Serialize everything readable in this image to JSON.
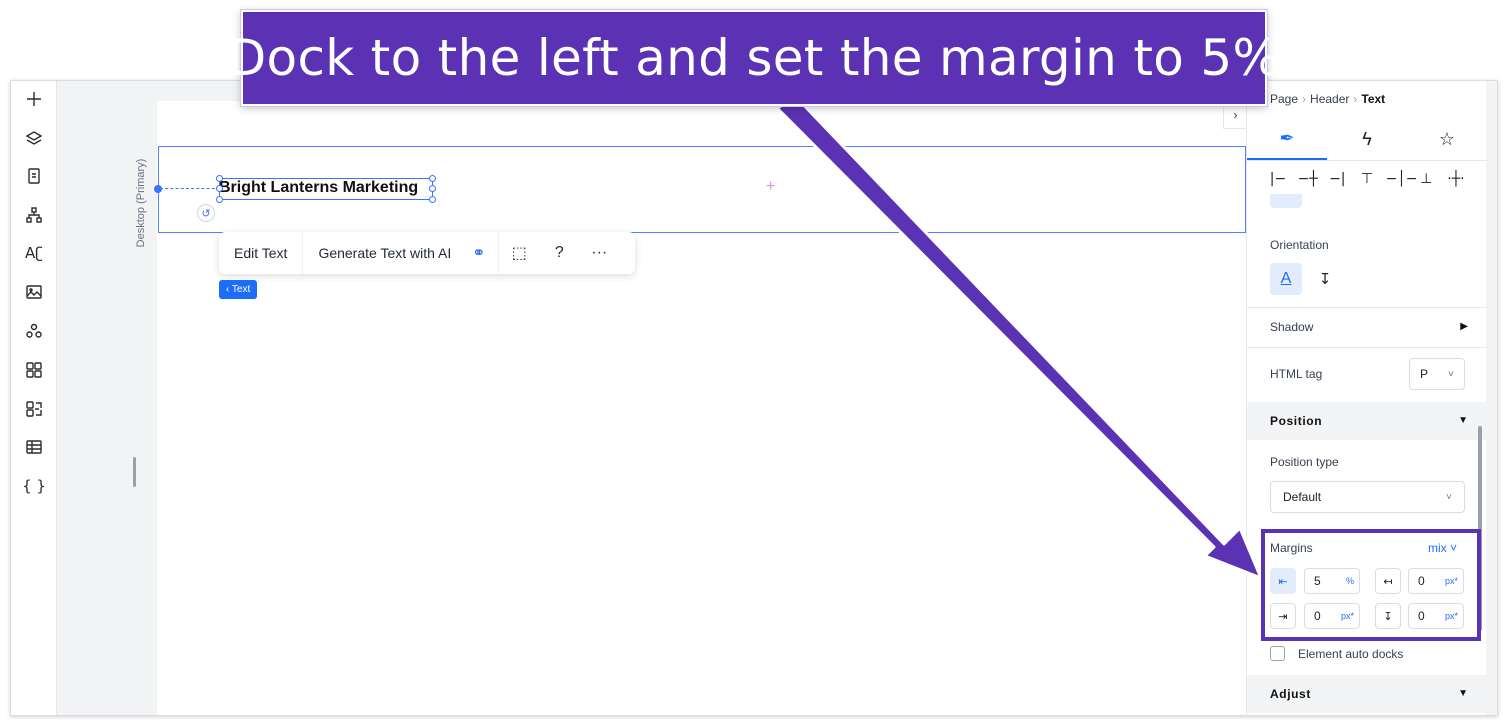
{
  "annotation": {
    "instruction": "Dock to the left and set the margin to 5%"
  },
  "left_toolbar": {
    "items": [
      {
        "name": "add-elements-icon"
      },
      {
        "name": "layers-icon"
      },
      {
        "name": "pages-icon"
      },
      {
        "name": "site-structure-icon"
      },
      {
        "name": "theme-fonts-icon",
        "glyph": "Aʗ"
      },
      {
        "name": "media-icon"
      },
      {
        "name": "apps-cluster-icon"
      },
      {
        "name": "app-market-icon"
      },
      {
        "name": "business-apps-icon"
      },
      {
        "name": "cms-table-icon"
      },
      {
        "name": "code-icon",
        "glyph": "{ }"
      }
    ]
  },
  "canvas": {
    "breakpoint_label": "Desktop (Primary)",
    "selected_text": "Bright Lanterns Marketing",
    "collapse_glyph": "›",
    "plus_glyph": "+",
    "rotate_glyph": "↺",
    "floating_toolbar": {
      "edit_text": "Edit Text",
      "generate_ai": "Generate Text with AI",
      "link_glyph": "⚭",
      "comment_glyph": "⬚",
      "help_glyph": "?",
      "more_glyph": "···"
    },
    "element_chip": "‹ Text"
  },
  "panel": {
    "breadcrumb": {
      "page": "Page",
      "header": "Header",
      "current": "Text",
      "separator": "›"
    },
    "tabs": [
      {
        "name": "tab-design",
        "glyph": "✒",
        "active": true
      },
      {
        "name": "tab-interactions",
        "glyph": "ϟ",
        "active": false
      },
      {
        "name": "tab-tips",
        "glyph": "☆",
        "active": false
      }
    ],
    "align_glyphs": [
      "|−",
      "−┼",
      "−|",
      "⊤",
      "−│−",
      "⊥",
      "·┼·"
    ],
    "orientation": {
      "label": "Orientation",
      "horizontal_glyph": "A",
      "vertical_glyph": "↧"
    },
    "shadow": {
      "label": "Shadow",
      "caret": "▶"
    },
    "html_tag": {
      "label": "HTML tag",
      "value": "P",
      "caret": "˅"
    },
    "position_section": {
      "label": "Position",
      "caret": "▼"
    },
    "position_type": {
      "label": "Position type",
      "value": "Default",
      "caret": "˅"
    },
    "margins": {
      "label": "Margins",
      "mode": "mix ˅",
      "left": {
        "value": "5",
        "unit": "%"
      },
      "top": {
        "value": "0",
        "unit": "px*"
      },
      "right": {
        "value": "0",
        "unit": "px*"
      },
      "bottom": {
        "value": "0",
        "unit": "px*"
      }
    },
    "auto_docks": {
      "label": "Element auto docks",
      "checked": false
    },
    "adjust_section": {
      "label": "Adjust",
      "caret": "▼"
    }
  },
  "colors": {
    "annotation_purple": "#5b32b3",
    "accent_blue": "#1c6dfa",
    "selection_blue": "#3a73ff"
  }
}
